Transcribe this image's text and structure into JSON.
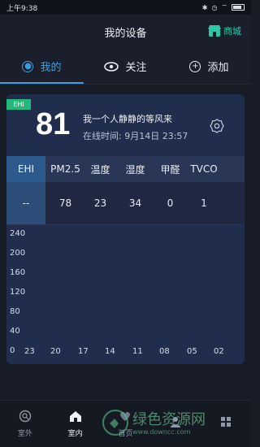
{
  "status": {
    "time": "上午9:38",
    "icons": [
      "bluetooth-icon",
      "alarm-icon",
      "wifi-icon",
      "battery-icon"
    ]
  },
  "header": {
    "title": "我的设备",
    "mall_label": "商城",
    "mall_icon": "store-icon"
  },
  "tabs": [
    {
      "label": "我的",
      "icon": "user-icon",
      "active": true
    },
    {
      "label": "关注",
      "icon": "eye-icon",
      "active": false
    },
    {
      "label": "添加",
      "icon": "plus-icon",
      "active": false
    }
  ],
  "device": {
    "badge": "EHI",
    "score": "81",
    "name": "我一个人静静的等风来",
    "online_label": "在线时间:",
    "online_time": "9月14日 23:57"
  },
  "table": {
    "headers": [
      "EHI",
      "PM2.5",
      "温度",
      "湿度",
      "甲醛",
      "TVCO"
    ],
    "values": [
      "--",
      "78",
      "23",
      "34",
      "0",
      "1"
    ]
  },
  "chart_data": {
    "type": "line",
    "y_ticks": [
      "240",
      "200",
      "160",
      "120",
      "80",
      "40",
      "0"
    ],
    "x_ticks": [
      "23",
      "20",
      "17",
      "14",
      "11",
      "08",
      "05",
      "02"
    ],
    "ylim": [
      0,
      240
    ],
    "series": []
  },
  "nav": [
    {
      "label": "室外",
      "icon": "search-icon",
      "active": false
    },
    {
      "label": "室内",
      "icon": "home-icon",
      "active": true
    },
    {
      "label": "首页",
      "icon": "heart-icon",
      "active": false
    },
    {
      "label": "",
      "icon": "blank",
      "active": false
    },
    {
      "label": "",
      "icon": "blank",
      "active": false
    }
  ],
  "watermark": {
    "text": "绿色资源网",
    "url": "www.downcc.com"
  },
  "colors": {
    "accent": "#3b9ee4",
    "brand_green": "#24b97a",
    "card": "#212d4d",
    "background": "#181c27"
  }
}
